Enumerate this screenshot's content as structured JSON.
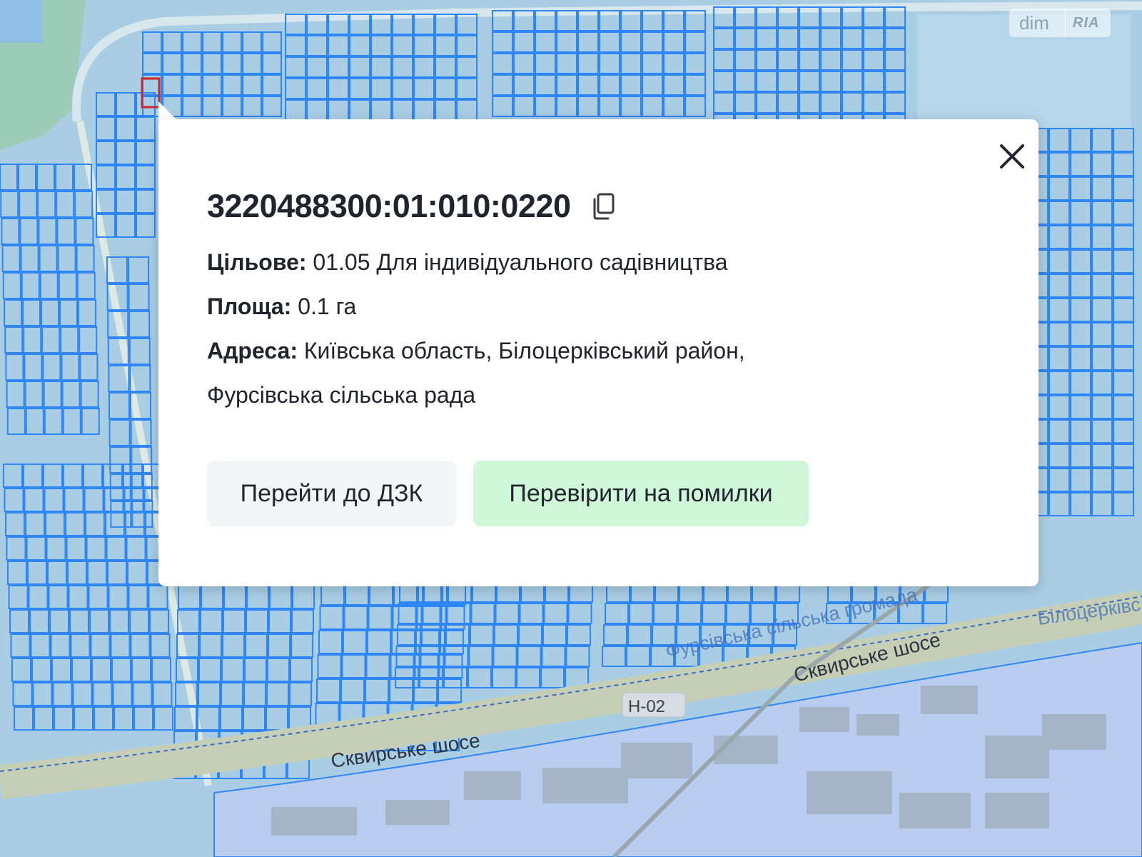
{
  "map": {
    "labels": {
      "district": "Фурсівська сільська громада",
      "district_right": "Білоцерківс",
      "road_upper": "Сквирське шосе",
      "road_lower": "Сквирське шосе",
      "road_code": "Н-02"
    },
    "colors": {
      "parcel_fill": "#a9cde3",
      "parcel_stroke": "#2f86f6",
      "selected_parcel": "#d0262a",
      "green_area": "#9ccbb8",
      "road": "#c8d4bd",
      "industrial": "#b9cdf0"
    }
  },
  "watermark": {
    "part1": "dim",
    "part2": "RIA"
  },
  "popup": {
    "cadastral_number": "3220488300:01:010:0220",
    "copy_icon": "copy-icon",
    "close_icon": "close-icon",
    "fields": [
      {
        "label": "Цільове:",
        "value": "01.05 Для індивідуального садівництва"
      },
      {
        "label": "Площа:",
        "value": "0.1 га"
      },
      {
        "label": "Адреса:",
        "value": "Київська область, Білоцерківський район,"
      }
    ],
    "address_continuation": "Фурсівська сільська рада",
    "buttons": {
      "dzk": "Перейти до ДЗК",
      "check": "Перевірити на помилки"
    }
  }
}
